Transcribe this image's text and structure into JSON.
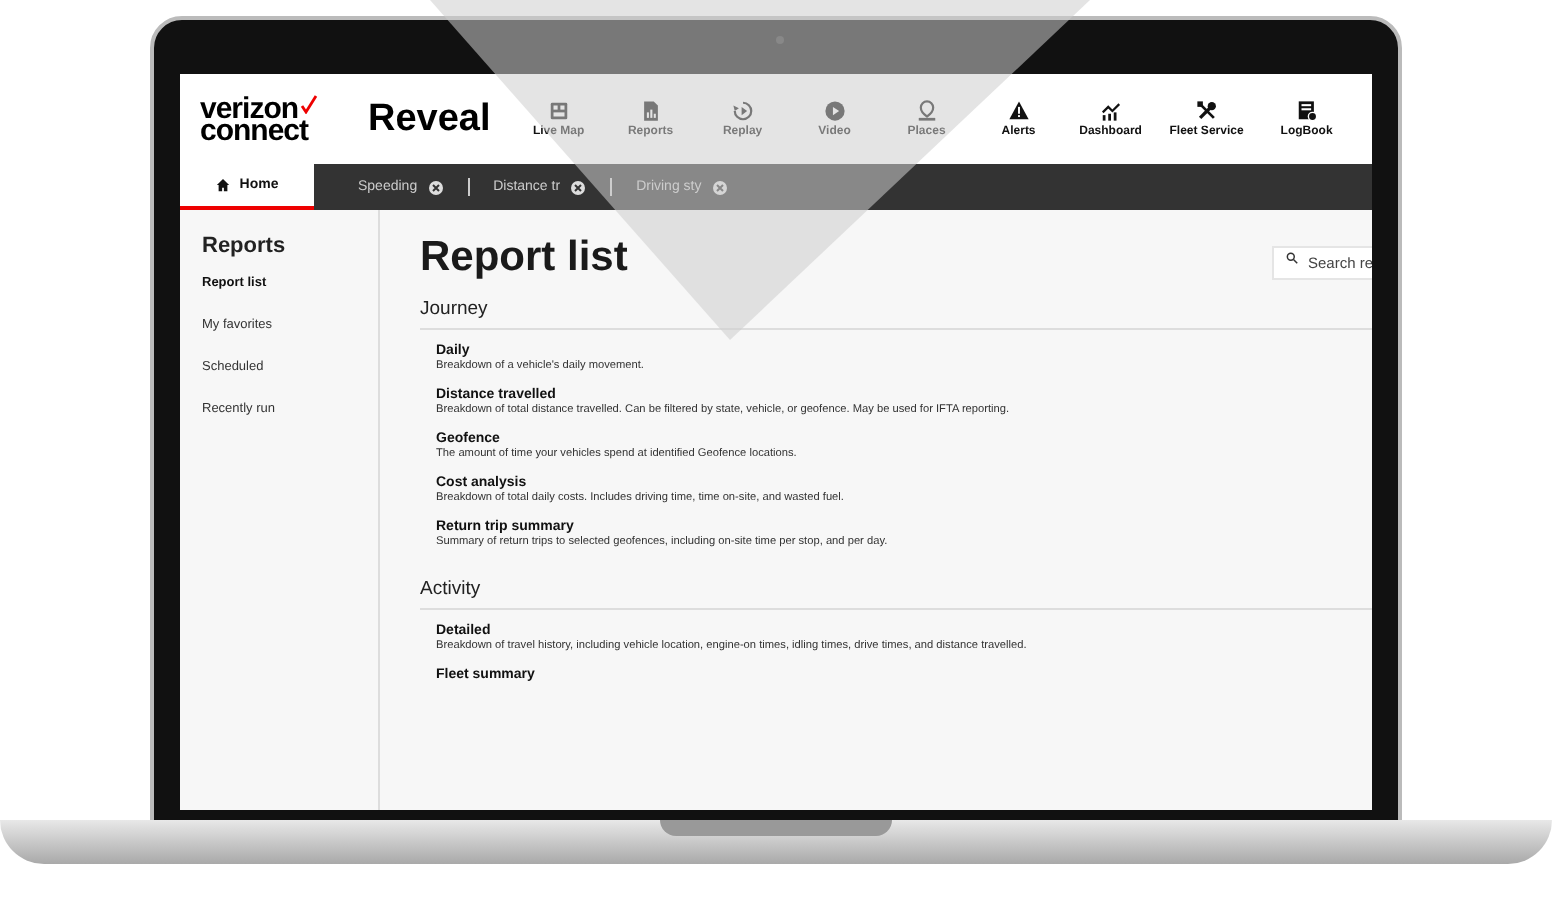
{
  "header": {
    "logo_line_1": "verizon",
    "logo_line_2": "connect",
    "product": "Reveal",
    "nav": [
      {
        "label": "Live Map"
      },
      {
        "label": "Reports"
      },
      {
        "label": "Replay"
      },
      {
        "label": "Video"
      },
      {
        "label": "Places"
      },
      {
        "label": "Alerts"
      },
      {
        "label": "Dashboard"
      },
      {
        "label": "Fleet Service"
      },
      {
        "label": "LogBook"
      }
    ]
  },
  "tabs": [
    {
      "label": "Home",
      "selected": true,
      "closable": false
    },
    {
      "label": "Speeding",
      "selected": false,
      "closable": true
    },
    {
      "label": "Distance tr",
      "selected": false,
      "closable": true
    },
    {
      "label": "Driving sty",
      "selected": false,
      "closable": true
    }
  ],
  "sidebar": {
    "title": "Reports",
    "items": [
      {
        "label": "Report list",
        "selected": true
      },
      {
        "label": "My favorites",
        "selected": false
      },
      {
        "label": "Scheduled",
        "selected": false
      },
      {
        "label": "Recently run",
        "selected": false
      }
    ]
  },
  "main": {
    "title": "Report list",
    "search": {
      "placeholder": "Search re"
    },
    "sections": [
      {
        "title": "Journey",
        "reports": [
          {
            "name": "Daily",
            "description": "Breakdown of a vehicle's daily movement."
          },
          {
            "name": "Distance travelled",
            "description": "Breakdown of total distance travelled. Can be filtered by state, vehicle, or geofence. May be used for IFTA reporting."
          },
          {
            "name": "Geofence",
            "description": "The amount of time your vehicles spend at identified Geofence locations."
          },
          {
            "name": "Cost analysis",
            "description": "Breakdown of total daily costs. Includes driving time, time on-site, and wasted fuel."
          },
          {
            "name": "Return trip summary",
            "description": "Summary of return trips to selected geofences, including on-site time per stop, and per day."
          }
        ]
      },
      {
        "title": "Activity",
        "reports": [
          {
            "name": "Detailed",
            "description": "Breakdown of travel history, including vehicle location, engine-on times, idling times, drive times, and distance travelled."
          },
          {
            "name": "Fleet summary"
          }
        ]
      }
    ]
  }
}
